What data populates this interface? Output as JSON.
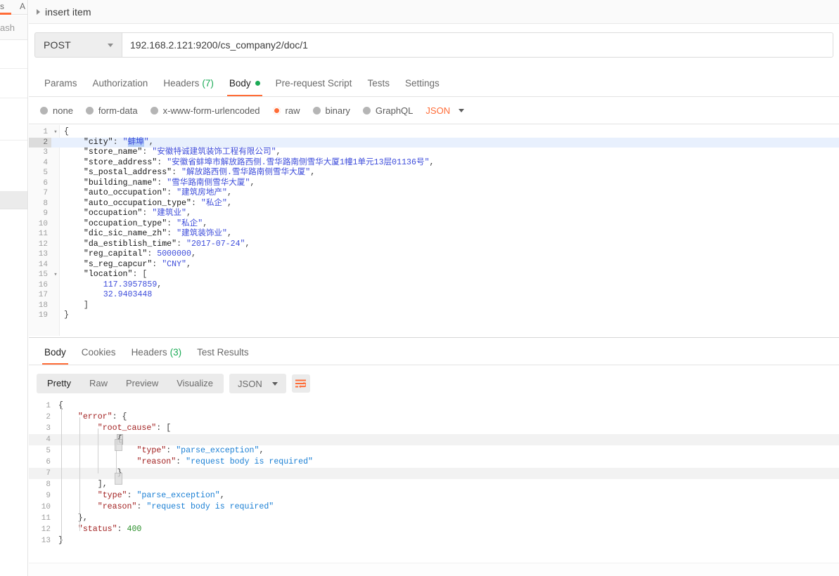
{
  "left_rail": {
    "tab_a": "s",
    "tab_b": "A",
    "search_text": "ash"
  },
  "breadcrumb": {
    "caret_icon": "triangle-right-icon",
    "title": "insert item"
  },
  "url_bar": {
    "method": "POST",
    "method_caret_icon": "chevron-down-icon",
    "url": "192.168.2.121:9200/cs_company2/doc/1"
  },
  "request_tabs": [
    {
      "label": "Params",
      "active": false,
      "count": null,
      "dot": false
    },
    {
      "label": "Authorization",
      "active": false,
      "count": null,
      "dot": false
    },
    {
      "label": "Headers",
      "active": false,
      "count": "(7)",
      "dot": false
    },
    {
      "label": "Body",
      "active": true,
      "count": null,
      "dot": true
    },
    {
      "label": "Pre-request Script",
      "active": false,
      "count": null,
      "dot": false
    },
    {
      "label": "Tests",
      "active": false,
      "count": null,
      "dot": false
    },
    {
      "label": "Settings",
      "active": false,
      "count": null,
      "dot": false
    }
  ],
  "body_types": [
    {
      "label": "none",
      "selected": false
    },
    {
      "label": "form-data",
      "selected": false
    },
    {
      "label": "x-www-form-urlencoded",
      "selected": false
    },
    {
      "label": "raw",
      "selected": true
    },
    {
      "label": "binary",
      "selected": false
    },
    {
      "label": "GraphQL",
      "selected": false
    }
  ],
  "body_format": {
    "label": "JSON",
    "caret_icon": "chevron-down-icon"
  },
  "request_body": {
    "active_line": 2,
    "selected_text": "蚌埠",
    "lines": [
      {
        "n": 1,
        "fold": "▾",
        "text": "{"
      },
      {
        "n": 2,
        "fold": "",
        "text": "    \"city\": \"蚌埠\","
      },
      {
        "n": 3,
        "fold": "",
        "text": "    \"store_name\": \"安徽特诚建筑装饰工程有限公司\","
      },
      {
        "n": 4,
        "fold": "",
        "text": "    \"store_address\": \"安徽省蚌埠市解放路西侧.雪华路南侧雪华大厦1幢1单元13层01136号\","
      },
      {
        "n": 5,
        "fold": "",
        "text": "    \"s_postal_address\": \"解放路西侧.雪华路南侧雪华大厦\","
      },
      {
        "n": 6,
        "fold": "",
        "text": "    \"building_name\": \"雪华路南侧雪华大厦\","
      },
      {
        "n": 7,
        "fold": "",
        "text": "    \"auto_occupation\": \"建筑房地产\","
      },
      {
        "n": 8,
        "fold": "",
        "text": "    \"auto_occupation_type\": \"私企\","
      },
      {
        "n": 9,
        "fold": "",
        "text": "    \"occupation\": \"建筑业\","
      },
      {
        "n": 10,
        "fold": "",
        "text": "    \"occupation_type\": \"私企\","
      },
      {
        "n": 11,
        "fold": "",
        "text": "    \"dic_sic_name_zh\": \"建筑装饰业\","
      },
      {
        "n": 12,
        "fold": "",
        "text": "    \"da_estiblish_time\": \"2017-07-24\","
      },
      {
        "n": 13,
        "fold": "",
        "text": "    \"reg_capital\": 5000000,"
      },
      {
        "n": 14,
        "fold": "",
        "text": "    \"s_reg_capcur\": \"CNY\","
      },
      {
        "n": 15,
        "fold": "▾",
        "text": "    \"location\": ["
      },
      {
        "n": 16,
        "fold": "",
        "text": "        117.3957859,"
      },
      {
        "n": 17,
        "fold": "",
        "text": "        32.9403448"
      },
      {
        "n": 18,
        "fold": "",
        "text": "    ]"
      },
      {
        "n": 19,
        "fold": "",
        "text": "}"
      }
    ]
  },
  "response_tabs": [
    {
      "label": "Body",
      "active": true,
      "count": null
    },
    {
      "label": "Cookies",
      "active": false,
      "count": null
    },
    {
      "label": "Headers",
      "active": false,
      "count": "(3)"
    },
    {
      "label": "Test Results",
      "active": false,
      "count": null
    }
  ],
  "response_toolbar": {
    "views": [
      {
        "label": "Pretty",
        "active": true
      },
      {
        "label": "Raw",
        "active": false
      },
      {
        "label": "Preview",
        "active": false
      },
      {
        "label": "Visualize",
        "active": false
      }
    ],
    "format": "JSON",
    "format_caret_icon": "chevron-down-icon",
    "wrap_icon": "word-wrap-icon"
  },
  "response_body": {
    "lines": [
      {
        "n": 1,
        "text": "{"
      },
      {
        "n": 2,
        "text": "    \"error\": {"
      },
      {
        "n": 3,
        "text": "        \"root_cause\": ["
      },
      {
        "n": 4,
        "text": "            {"
      },
      {
        "n": 5,
        "text": "                \"type\": \"parse_exception\","
      },
      {
        "n": 6,
        "text": "                \"reason\": \"request body is required\""
      },
      {
        "n": 7,
        "text": "            }"
      },
      {
        "n": 8,
        "text": "        ],"
      },
      {
        "n": 9,
        "text": "        \"type\": \"parse_exception\","
      },
      {
        "n": 10,
        "text": "        \"reason\": \"request body is required\""
      },
      {
        "n": 11,
        "text": "    },"
      },
      {
        "n": 12,
        "text": "    \"status\": 400"
      },
      {
        "n": 13,
        "text": "}"
      }
    ]
  },
  "colors": {
    "accent": "#ff6c37",
    "green": "#1aaa55",
    "request_string": "#3e4ddb",
    "response_key": "#a11f1f",
    "response_string": "#1a7fd4",
    "response_number": "#2a8f2a"
  }
}
